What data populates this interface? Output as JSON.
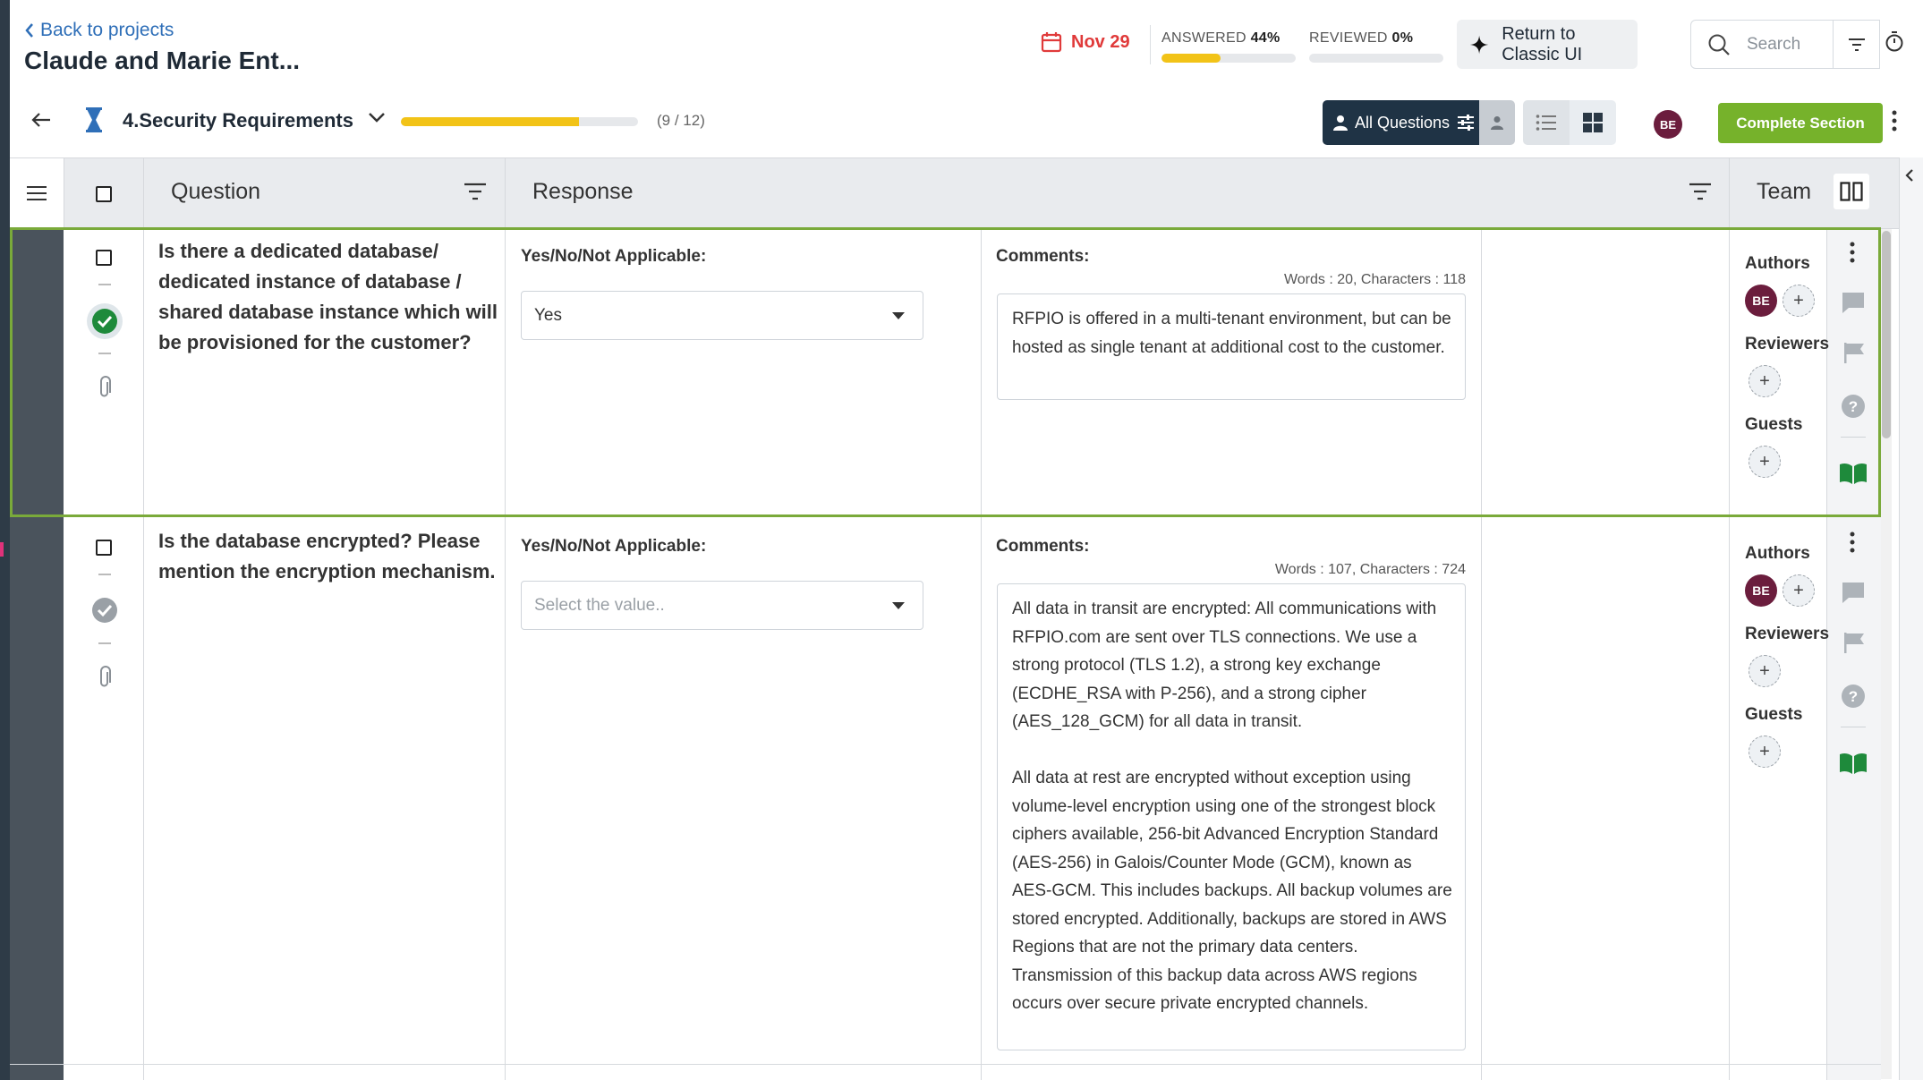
{
  "header": {
    "back_label": "Back to projects",
    "project_title": "Claude and Marie Ent...",
    "due_date": "Nov 29",
    "answered_label": "ANSWERED",
    "answered_pct": "44%",
    "answered_value": 0.44,
    "reviewed_label": "REVIEWED",
    "reviewed_pct": "0%",
    "reviewed_value": 0,
    "classic_ui_label": "Return to Classic UI",
    "search_placeholder": "Search"
  },
  "section": {
    "name": "4.Security Requirements",
    "progress_value": 0.75,
    "count": "(9 / 12)",
    "all_questions_label": "All Questions",
    "user_initials": "BE",
    "complete_label": "Complete Section"
  },
  "columns": {
    "question": "Question",
    "response": "Response",
    "team": "Team"
  },
  "rows": [
    {
      "question": "Is there a dedicated database/ dedicated instance of database / shared database instance which will be provisioned for the customer?",
      "response_label": "Yes/No/Not Applicable:",
      "response_value": "Yes",
      "comments_label": "Comments:",
      "word_count": "Words : 20, Characters : 118",
      "comment": "RFPIO is offered in a multi-tenant environment, but can be hosted as single tenant at additional cost to the customer.",
      "authors_label": "Authors",
      "author_initials": "BE",
      "reviewers_label": "Reviewers",
      "guests_label": "Guests"
    },
    {
      "question": "Is the database encrypted? Please mention the encryption mechanism.",
      "response_label": "Yes/No/Not Applicable:",
      "response_placeholder": "Select the value..",
      "comments_label": "Comments:",
      "word_count": "Words : 107, Characters : 724",
      "comment": "All data in transit are encrypted:  All communications with RFPIO.com are sent over TLS connections.  We use a strong protocol (TLS 1.2), a strong key exchange (ECDHE_RSA with P-256), and a strong cipher (AES_128_GCM) for all data in transit.\n\nAll data at rest are encrypted without exception using volume-level encryption using one of the strongest block ciphers available, 256-bit Advanced Encryption Standard (AES-256) in Galois/Counter Mode (GCM), known as AES-GCM.  This includes backups.  All backup volumes are stored encrypted.  Additionally, backups are stored in AWS Regions that are not the primary data centers.  Transmission of this backup data across AWS regions occurs over secure private encrypted channels.",
      "authors_label": "Authors",
      "author_initials": "BE",
      "reviewers_label": "Reviewers",
      "guests_label": "Guests"
    }
  ],
  "colors": {
    "accent_green": "#76b22b",
    "selected_border": "#7aaa3a",
    "progress_yellow": "#f2c317",
    "due_red": "#e03a3a",
    "dark_navy": "#1f3345"
  }
}
